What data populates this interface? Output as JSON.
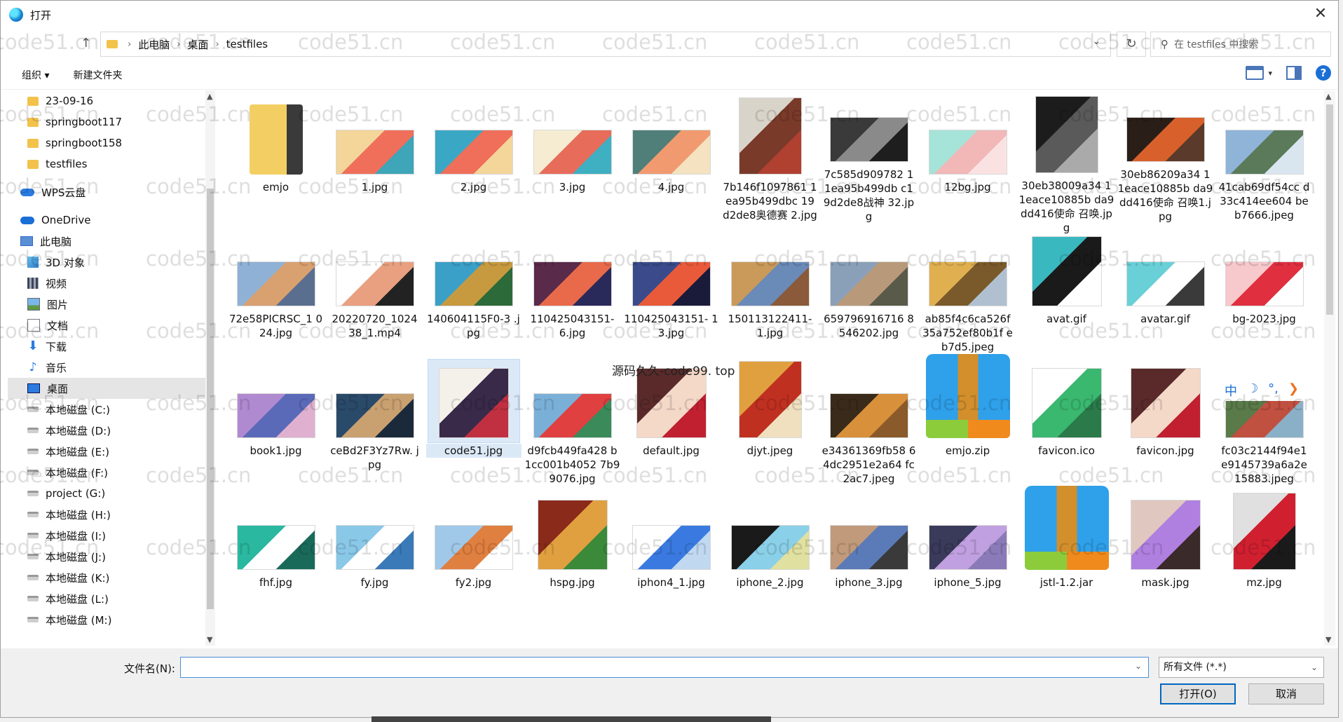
{
  "window": {
    "title": "打开"
  },
  "address": {
    "crumbs": [
      "此电脑",
      "桌面",
      "testfiles"
    ],
    "search_placeholder": "在 testfiles 中搜索"
  },
  "toolbar": {
    "organize": "组织 ▾",
    "new_folder": "新建文件夹"
  },
  "sidebar": {
    "items": [
      {
        "label": "23-09-16",
        "icon": "folder-icon"
      },
      {
        "label": "springboot117",
        "icon": "folder-icon"
      },
      {
        "label": "springboot158",
        "icon": "folder-icon"
      },
      {
        "label": "testfiles",
        "icon": "folder-icon"
      },
      {
        "label": "",
        "icon": ""
      },
      {
        "label": "WPS云盘",
        "icon": "cloud-icon"
      },
      {
        "label": "",
        "icon": ""
      },
      {
        "label": "OneDrive",
        "icon": "onedrive-icon"
      },
      {
        "label": "此电脑",
        "icon": "computer-icon"
      },
      {
        "label": "3D 对象",
        "icon": "cube-icon"
      },
      {
        "label": "视频",
        "icon": "video-icon"
      },
      {
        "label": "图片",
        "icon": "picture-icon"
      },
      {
        "label": "文档",
        "icon": "document-icon"
      },
      {
        "label": "下载",
        "icon": "download-icon"
      },
      {
        "label": "音乐",
        "icon": "music-icon"
      },
      {
        "label": "桌面",
        "icon": "desktop-icon"
      },
      {
        "label": "本地磁盘 (C:)",
        "icon": "drive-icon"
      },
      {
        "label": "本地磁盘 (D:)",
        "icon": "drive-icon"
      },
      {
        "label": "本地磁盘 (E:)",
        "icon": "drive-icon"
      },
      {
        "label": "本地磁盘 (F:)",
        "icon": "drive-icon"
      },
      {
        "label": "project (G:)",
        "icon": "drive-icon"
      },
      {
        "label": "本地磁盘 (H:)",
        "icon": "drive-icon"
      },
      {
        "label": "本地磁盘 (I:)",
        "icon": "drive-icon"
      },
      {
        "label": "本地磁盘 (J:)",
        "icon": "drive-icon"
      },
      {
        "label": "本地磁盘 (K:)",
        "icon": "drive-icon"
      },
      {
        "label": "本地磁盘 (L:)",
        "icon": "drive-icon"
      },
      {
        "label": "本地磁盘 (M:)",
        "icon": "drive-icon"
      }
    ],
    "selected": "桌面"
  },
  "files": [
    {
      "name": "emjo",
      "kind": "folder"
    },
    {
      "name": "1.jpg",
      "colors": [
        "#f4d59a",
        "#ef6f5a",
        "#3fa5b8"
      ]
    },
    {
      "name": "2.jpg",
      "colors": [
        "#3aa7c4",
        "#ef6f5a",
        "#f4d59a"
      ]
    },
    {
      "name": "3.jpg",
      "colors": [
        "#f6ecd2",
        "#e76c5a",
        "#3fb0c2"
      ]
    },
    {
      "name": "4.jpg",
      "colors": [
        "#4f7f78",
        "#f19a6f",
        "#f4e2c0"
      ]
    },
    {
      "name": "7b146f1097861 1ea95b499dbc 19d2de8奥德赛 2.jpg",
      "kind": "portrait",
      "colors": [
        "#d9d4c9",
        "#7a3a2a",
        "#b04030"
      ]
    },
    {
      "name": "7c585d909782 11ea95b499db c19d2de8战神 32.jpg",
      "colors": [
        "#3a3a3a",
        "#8a8a8a",
        "#1e1e1e"
      ]
    },
    {
      "name": "12bg.jpg",
      "colors": [
        "#a6e3d8",
        "#f2b7b7",
        "#fbe2e2"
      ]
    },
    {
      "name": "30eb38009a34 11eace10885b da9dd416使命 召唤.jpg",
      "kind": "portrait",
      "colors": [
        "#1c1c1c",
        "#5a5a5a",
        "#aaaaaa"
      ]
    },
    {
      "name": "30eb86209a34 11eace10885b da9dd416使命 召唤1.jpg",
      "colors": [
        "#2a1e18",
        "#d8602a",
        "#5a3a2a"
      ]
    },
    {
      "name": "41cab69df54cc d33c414ee604 beb7666.jpeg",
      "colors": [
        "#8fb4d8",
        "#5b7a5a",
        "#d9e6f0"
      ]
    },
    {
      "name": "72e58PICRSC_1 024.jpg",
      "colors": [
        "#8fb1d6",
        "#d9a070",
        "#5a6f8f"
      ]
    },
    {
      "name": "20220720_1024 38_1.mp4",
      "colors": [
        "#ffffff",
        "#e8a080",
        "#222222"
      ]
    },
    {
      "name": "140604115F0-3 .jpg",
      "colors": [
        "#3aa0c8",
        "#c79a40",
        "#2c6a3a"
      ]
    },
    {
      "name": "110425043151- 6.jpg",
      "colors": [
        "#5a2a4a",
        "#e86a4a",
        "#2a2a5a"
      ]
    },
    {
      "name": "110425043151- 13.jpg",
      "colors": [
        "#3a4a8a",
        "#e85a3a",
        "#1a1a3a"
      ]
    },
    {
      "name": "150113122411- 1.jpg",
      "colors": [
        "#c99a5a",
        "#6a8ab8",
        "#8a5a3a"
      ]
    },
    {
      "name": "659796916716 8546202.jpg",
      "colors": [
        "#8aa0b8",
        "#b89a7a",
        "#5a5a4a"
      ]
    },
    {
      "name": "ab85f4c6ca526f 35a752ef80b1f eb7d5.jpeg",
      "colors": [
        "#e0b050",
        "#7a5a2a",
        "#b0c0d0"
      ]
    },
    {
      "name": "avat.gif",
      "kind": "square",
      "colors": [
        "#3ab8c0",
        "#1a1a1a",
        "#ffffff"
      ]
    },
    {
      "name": "avatar.gif",
      "colors": [
        "#6ad0d8",
        "#ffffff",
        "#3a3a3a"
      ]
    },
    {
      "name": "bg-2023.jpg",
      "colors": [
        "#f7c8cc",
        "#e03040",
        "#ffffff"
      ]
    },
    {
      "name": "book1.jpg",
      "colors": [
        "#b08ad0",
        "#5a6ab8",
        "#e0b0d0"
      ]
    },
    {
      "name": "ceBd2F3Yz7Rw. jpg",
      "colors": [
        "#2a4a6a",
        "#c9a070",
        "#1a2a3a"
      ]
    },
    {
      "name": "code51.jpg",
      "kind": "square",
      "colors": [
        "#f4f0ea",
        "#3a2a4a",
        "#c03040"
      ]
    },
    {
      "name": "d9fcb449fa428 b1cc001b4052 7b99076.jpg",
      "colors": [
        "#7ab0d8",
        "#e04040",
        "#3a8a5a"
      ]
    },
    {
      "name": "default.jpg",
      "kind": "square",
      "colors": [
        "#5a2a2a",
        "#f4d8c8",
        "#c02030"
      ]
    },
    {
      "name": "djyt.jpeg",
      "kind": "portrait",
      "colors": [
        "#e0a040",
        "#c03020",
        "#f0e0c0"
      ]
    },
    {
      "name": "e34361369fb58 64dc2951e2a64 fc2ac7.jpeg",
      "colors": [
        "#3a2a1a",
        "#d8903a",
        "#8a5a2a"
      ]
    },
    {
      "name": "emjo.zip",
      "kind": "zip"
    },
    {
      "name": "favicon.ico",
      "kind": "square",
      "colors": [
        "#ffffff",
        "#3ab870",
        "#2a7a4a"
      ]
    },
    {
      "name": "favicon.jpg",
      "kind": "square",
      "colors": [
        "#5a2a2a",
        "#f4d8c8",
        "#c02030"
      ]
    },
    {
      "name": "fc03c2144f94e1 e9145739a6a2e 15883.jpeg",
      "colors": [
        "#5a7a4a",
        "#c05040",
        "#8ab0c8"
      ]
    },
    {
      "name": "fhf.jpg",
      "colors": [
        "#2ab8a0",
        "#ffffff",
        "#1a6a5a"
      ]
    },
    {
      "name": "fy.jpg",
      "colors": [
        "#8ac8e8",
        "#ffffff",
        "#3a7ab8"
      ]
    },
    {
      "name": "fy2.jpg",
      "colors": [
        "#a0c8e8",
        "#e08040",
        "#ffffff"
      ]
    },
    {
      "name": "hspg.jpg",
      "kind": "square",
      "colors": [
        "#8a2a1a",
        "#e0a040",
        "#3a8a3a"
      ]
    },
    {
      "name": "iphon4_1.jpg",
      "colors": [
        "#ffffff",
        "#3a7ae0",
        "#c0d8f0"
      ]
    },
    {
      "name": "iphone_2.jpg",
      "colors": [
        "#1a1a1a",
        "#8ad0e8",
        "#e0e0a0"
      ]
    },
    {
      "name": "iphone_3.jpg",
      "colors": [
        "#c09a7a",
        "#5a7ab8",
        "#3a3a3a"
      ]
    },
    {
      "name": "iphone_5.jpg",
      "colors": [
        "#3a3a5a",
        "#c0a0e0",
        "#8a7ab8"
      ]
    },
    {
      "name": "jstl-1.2.jar",
      "kind": "zip"
    },
    {
      "name": "mask.jpg",
      "kind": "square",
      "colors": [
        "#e0c8c0",
        "#b080e0",
        "#3a2a2a"
      ]
    },
    {
      "name": "mz.jpg",
      "kind": "portrait",
      "colors": [
        "#e0e0e0",
        "#d02030",
        "#1a1a1a"
      ]
    },
    {
      "name": "",
      "colors": [
        "#e8f0f8",
        "#3a6ab8",
        "#ffffff"
      ]
    },
    {
      "name": "",
      "colors": [
        "#a0c8e8",
        "#ffffff",
        "#e0e0e0"
      ]
    },
    {
      "name": "",
      "colors": [
        "#e0e0e0",
        "#f0f0f0",
        "#cccccc"
      ]
    },
    {
      "name": "",
      "colors": [
        "#f0e0e0",
        "#e08080",
        "#ffffff"
      ]
    },
    {
      "name": "",
      "colors": [
        "#f0e8c0",
        "#e0a040",
        "#ffffff"
      ]
    },
    {
      "name": "",
      "colors": [
        "#c8e8e0",
        "#ffffff",
        "#e0e0e0"
      ]
    },
    {
      "name": "",
      "colors": [
        "#c8e8e0",
        "#ffffff",
        "#e0e0e0"
      ]
    },
    {
      "name": "",
      "colors": [
        "#c8e0e8",
        "#ffffff",
        "#e0e0e0"
      ]
    },
    {
      "name": "",
      "colors": [
        "#f0d8d8",
        "#ffffff",
        "#e0e0e0"
      ]
    },
    {
      "name": "",
      "colors": [
        "#e0e0e0",
        "#ffffff",
        "#cccccc"
      ]
    },
    {
      "name": "",
      "colors": [
        "#f0e0a0",
        "#ffffff",
        "#e0e0e0"
      ]
    }
  ],
  "selected_file": "code51.jpg",
  "overlay_text": "源码久久-code99. top",
  "ime": {
    "mode": "中",
    "moon": "☽",
    "punct": "°,",
    "arrow": "❯"
  },
  "watermark": "code51.cn",
  "footer": {
    "filename_label": "文件名(N):",
    "filename_value": "",
    "filetype": "所有文件 (*.*)",
    "open_button": "打开(O)",
    "cancel_button": "取消"
  }
}
